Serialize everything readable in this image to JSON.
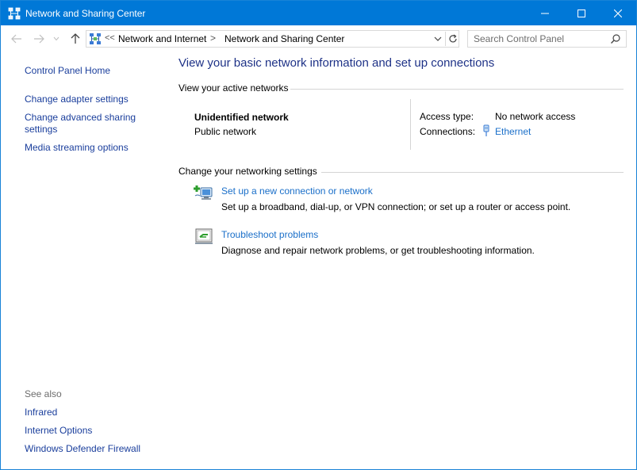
{
  "window": {
    "title": "Network and Sharing Center",
    "accent_color": "#0078d7",
    "controls": [
      "minimize-icon",
      "maximize-icon",
      "close-icon"
    ]
  },
  "navigation": {
    "back_icon": "arrow-left-icon",
    "forward_icon": "arrow-right-icon",
    "recent_icon": "chevron-down-icon",
    "up_icon": "arrow-up-icon"
  },
  "address_bar": {
    "overflow_marker": "<<",
    "breadcrumbs": [
      "Network and Internet",
      "Network and Sharing Center"
    ],
    "separator": ">",
    "dropdown_icon": "chevron-down-icon",
    "refresh_icon": "refresh-icon"
  },
  "search": {
    "placeholder": "Search Control Panel",
    "icon": "search-icon"
  },
  "left_pane": {
    "home": "Control Panel Home",
    "links": [
      "Change adapter settings",
      "Change advanced sharing settings",
      "Media streaming options"
    ],
    "see_also_heading": "See also",
    "see_also": [
      "Infrared",
      "Internet Options",
      "Windows Defender Firewall"
    ]
  },
  "main": {
    "title": "View your basic network information and set up connections",
    "active_networks_heading": "View your active networks",
    "network": {
      "name": "Unidentified network",
      "category": "Public network",
      "access_type_label": "Access type:",
      "access_type_value": "No network access",
      "connections_label": "Connections:",
      "connection": "Ethernet",
      "connection_icon": "ethernet-icon"
    },
    "settings_heading": "Change your networking settings",
    "tasks": [
      {
        "label": "Set up a new connection or network",
        "description": "Set up a broadband, dial-up, or VPN connection; or set up a router or access point.",
        "icon": "new-connection-icon"
      },
      {
        "label": "Troubleshoot problems",
        "description": "Diagnose and repair network problems, or get troubleshooting information.",
        "icon": "troubleshoot-icon"
      }
    ]
  },
  "colors": {
    "link": "#1a6fc9",
    "left_link": "#1a3e9c",
    "title_text": "#1e3287",
    "muted": "#6d6d6d"
  }
}
